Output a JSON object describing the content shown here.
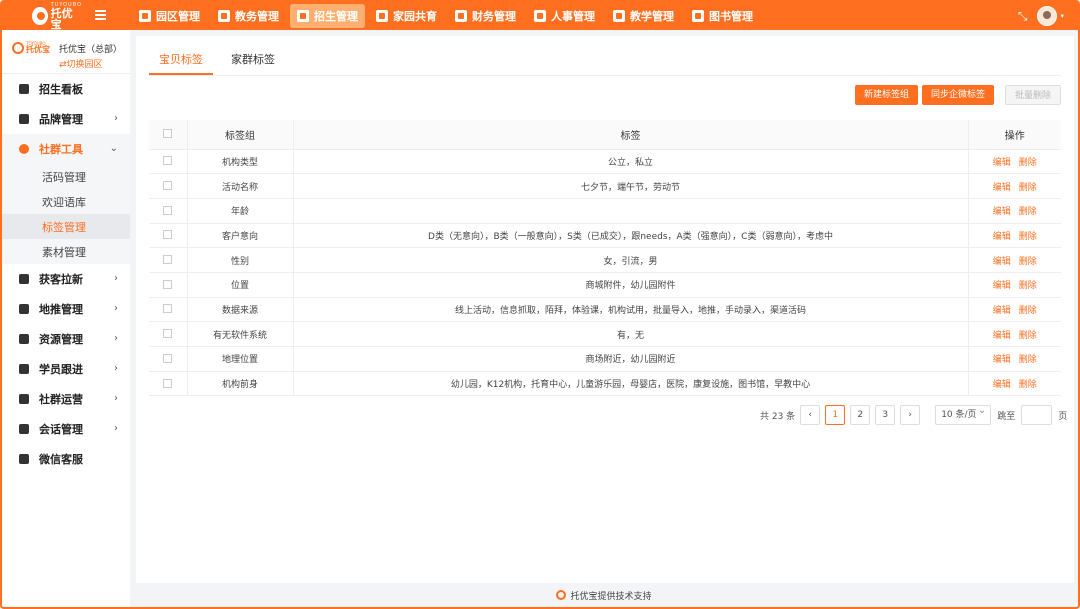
{
  "brand": {
    "small": "TUYOUBO",
    "big": "托优宝"
  },
  "nav": [
    {
      "label": "园区管理",
      "icon": "campus-icon",
      "active": false
    },
    {
      "label": "教务管理",
      "icon": "academic-icon",
      "active": false
    },
    {
      "label": "招生管理",
      "icon": "enrollment-icon",
      "active": true
    },
    {
      "label": "家园共育",
      "icon": "home-school-icon",
      "active": false
    },
    {
      "label": "财务管理",
      "icon": "finance-icon",
      "active": false
    },
    {
      "label": "人事管理",
      "icon": "hr-icon",
      "active": false
    },
    {
      "label": "教学管理",
      "icon": "teaching-icon",
      "active": false
    },
    {
      "label": "图书管理",
      "icon": "library-icon",
      "active": false
    }
  ],
  "org": {
    "logo_small": "TOYOUBO",
    "logo_big": "托优宝",
    "name": "托优宝（总部）",
    "switch": "⇄切换园区"
  },
  "sidebar": {
    "items_top": [
      {
        "label": "招生看板",
        "icon": "dashboard-icon",
        "arrow": ""
      },
      {
        "label": "品牌管理",
        "icon": "diamond-icon",
        "arrow": "›"
      }
    ],
    "open_item": {
      "label": "社群工具",
      "icon": "community-icon",
      "arrow": "⌄"
    },
    "sub_items": [
      {
        "label": "活码管理",
        "active": false
      },
      {
        "label": "欢迎语库",
        "active": false
      },
      {
        "label": "标签管理",
        "active": true
      },
      {
        "label": "素材管理",
        "active": false
      }
    ],
    "items_bottom": [
      {
        "label": "获客拉新",
        "icon": "chart-icon",
        "arrow": "›"
      },
      {
        "label": "地推管理",
        "icon": "person-icon",
        "arrow": "›"
      },
      {
        "label": "资源管理",
        "icon": "resource-icon",
        "arrow": "›"
      },
      {
        "label": "学员跟进",
        "icon": "follow-icon",
        "arrow": "›"
      },
      {
        "label": "社群运营",
        "icon": "group-icon",
        "arrow": "›"
      },
      {
        "label": "会话管理",
        "icon": "chat-icon",
        "arrow": "›"
      },
      {
        "label": "微信客服",
        "icon": "wechat-icon",
        "arrow": ""
      }
    ]
  },
  "tabs": [
    {
      "label": "宝贝标签",
      "active": true
    },
    {
      "label": "家群标签",
      "active": false
    }
  ],
  "toolbar": {
    "new_group": "新建标签组",
    "sync": "同步企微标签",
    "batch_delete": "批量删除"
  },
  "table": {
    "headers": {
      "group": "标签组",
      "tags": "标签",
      "ops": "操作"
    },
    "edit_label": "编辑",
    "delete_label": "删除",
    "rows": [
      {
        "group": "机构类型",
        "tags": "公立，私立"
      },
      {
        "group": "活动名称",
        "tags": "七夕节，端午节，劳动节"
      },
      {
        "group": "年龄",
        "tags": ""
      },
      {
        "group": "客户意向",
        "tags": "D类（无意向），B类（一般意向），S类（已成交），跟needs，A类（强意向），C类（弱意向），考虑中"
      },
      {
        "group": "性别",
        "tags": "女，引流，男"
      },
      {
        "group": "位置",
        "tags": "商城附件，幼儿园附件"
      },
      {
        "group": "数据来源",
        "tags": "线上活动，信息抓取，陌拜，体验课，机构试用，批量导入，地推，手动录入，渠道活码"
      },
      {
        "group": "有无软件系统",
        "tags": "有，无"
      },
      {
        "group": "地理位置",
        "tags": "商场附近，幼儿园附近"
      },
      {
        "group": "机构前身",
        "tags": "幼儿园，K12机构，托育中心，儿童游乐园，母婴店，医院，康复设施，图书馆，早教中心"
      }
    ]
  },
  "pagination": {
    "total": "共 23 条",
    "pages": [
      "1",
      "2",
      "3"
    ],
    "current": "1",
    "prev": "‹",
    "next": "›",
    "page_size": "10 条/页",
    "jump_label": "跳至",
    "jump_unit": "页"
  },
  "footer": "托优宝提供技术支持"
}
